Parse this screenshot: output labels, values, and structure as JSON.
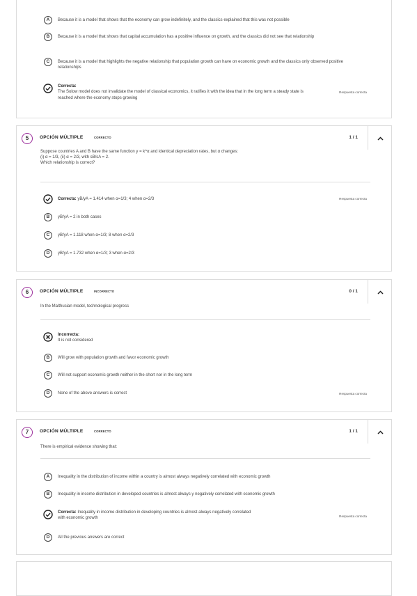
{
  "q4": {
    "options": [
      {
        "letter": "A",
        "text": "Because it is a model that shows that the economy can grow indefinitely, and the classics explained that this was not possible"
      },
      {
        "letter": "B",
        "text": "Because it is a model that shows that capital accumulation has a positive influence on growth, and the classics did not see that relationship"
      },
      {
        "letter": "C",
        "text": "Because it is a model that highlights the negative relationship that population growth can have on economic growth and the classics only observed positive relationships"
      }
    ],
    "answer_head": "Correcta:",
    "answer_text": "The Solow model does not invalidate the model of classical economics, it ratifies it with the idea that in the long term a steady state is reached where the economy stops growing",
    "answer_flag": "Respuesta correcta"
  },
  "q5": {
    "number": "5",
    "type": "OPCIÓN MÚLTIPLE",
    "status": "CORRECTO",
    "score": "1 / 1",
    "prompt_lines": [
      "Suppose countries A and B have the same function y = k^α and identical depreciation rates, but α changes:",
      "(i) α = 1/3,   (ii) α = 2/3, with sB/sA = 2.",
      "Which relationship is correct?"
    ],
    "answer_head": "Correcta:",
    "answer_text": "yB/yA = 1.414 when α=1/3; 4 when α=2/3",
    "answer_flag": "Respuesta correcta",
    "options": [
      {
        "letter": "B",
        "text": "yB/yA = 2 in both cases"
      },
      {
        "letter": "C",
        "text": "yB/yA = 1.118 when α=1/3; 8 when α=2/3"
      },
      {
        "letter": "D",
        "text": "yB/yA = 1.732 when α=1/3; 3 when α=2/3"
      }
    ]
  },
  "q6": {
    "number": "6",
    "type": "OPCIÓN MÚLTIPLE",
    "status": "INCORRECTO",
    "score": "0 / 1",
    "prompt": "In the Malthusian model, technological progress",
    "answer_head": "Incorrecta:",
    "answer_text": "It is not considered",
    "options": [
      {
        "letter": "B",
        "text": "Will grow with population growth and favor economic growth"
      },
      {
        "letter": "C",
        "text": "Will not support economic growth neither in the short nor in the long term"
      },
      {
        "letter": "D",
        "text": "None of the above answers is correct"
      }
    ],
    "correct_flag": "Respuesta correcta"
  },
  "q7": {
    "number": "7",
    "type": "OPCIÓN MÚLTIPLE",
    "status": "CORRECTO",
    "score": "1 / 1",
    "prompt": "There is empirical evidence showing that:",
    "options": [
      {
        "letter": "A",
        "text": "Inequality in the distribution of income within a country is almost always negatively correlated with economic growth"
      },
      {
        "letter": "B",
        "text": "Inequality in income distribution in developed countries is almost always y negatively correlated with economic growth"
      }
    ],
    "answer_head": "Correcta:",
    "answer_text_1": "Inequality in income distribution in developing countries is almost always negatively correlated",
    "answer_text_2": "with economic growth",
    "answer_flag": "Respuesta correcta",
    "last_option": {
      "letter": "D",
      "text": "All the previous answers are correct"
    }
  },
  "colors": {
    "accent": "#9b2d9b",
    "border": "#dcdcdc"
  }
}
